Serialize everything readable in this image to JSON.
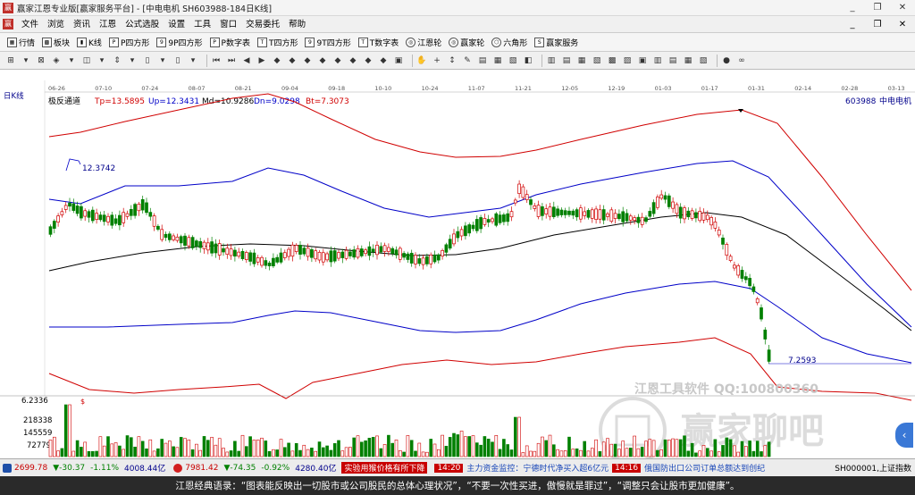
{
  "window": {
    "title": "赢家江恩专业版[赢家服务平台] - [中电电机  SH603988-184日K线]",
    "controls": [
      "_",
      "❐",
      "✕"
    ]
  },
  "menubar": {
    "items": [
      "文件",
      "浏览",
      "资讯",
      "江恩",
      "公式选股",
      "设置",
      "工具",
      "窗口",
      "交易委托",
      "帮助"
    ],
    "right_controls": [
      "_",
      "❐",
      "✕"
    ]
  },
  "toolbar1": {
    "items": [
      {
        "label": "行情",
        "icon": "grid-icon"
      },
      {
        "label": "板块",
        "icon": "blocks-icon"
      },
      {
        "label": "K线",
        "icon": "kline-icon"
      },
      {
        "label": "P四方形",
        "icon": "p-square-icon",
        "badge": "P"
      },
      {
        "label": "9P四方形",
        "icon": "9p-square-icon",
        "badge": "9"
      },
      {
        "label": "P数字表",
        "icon": "p-table-icon",
        "badge": "P"
      },
      {
        "label": "T四方形",
        "icon": "t-square-icon",
        "badge": "T"
      },
      {
        "label": "9T四方形",
        "icon": "9t-square-icon",
        "badge": "9"
      },
      {
        "label": "T数字表",
        "icon": "t-table-icon",
        "badge": "T"
      },
      {
        "label": "江恩轮",
        "icon": "gann-wheel-icon",
        "badge": "◎"
      },
      {
        "label": "赢家轮",
        "icon": "winner-wheel-icon",
        "badge": "◎"
      },
      {
        "label": "六角形",
        "icon": "hexagon-icon",
        "badge": "⬡"
      },
      {
        "label": "赢家服务",
        "icon": "service-icon",
        "badge": "S"
      }
    ]
  },
  "toolbar2": {
    "glyphs": [
      "⊞",
      "▾",
      "⊠",
      "◈",
      "▾",
      "◫",
      "▾",
      "⇕",
      "▾",
      "▯",
      "▾",
      "▯",
      "▾",
      "|",
      "⏮",
      "⏭",
      "◀",
      "▶",
      "◆",
      "◆",
      "◆",
      "◆",
      "◆",
      "◆",
      "◆",
      "◆",
      "▣",
      "|",
      "✋",
      "+",
      "↕",
      "✎",
      "▤",
      "▦",
      "▧",
      "◧",
      "|",
      "▥",
      "▤",
      "▦",
      "▧",
      "▩",
      "▨",
      "▣",
      "▥",
      "▤",
      "▦",
      "▧",
      "|",
      "●",
      "∞"
    ]
  },
  "chart": {
    "period_label": "日K线",
    "indicator_name": "极反通道",
    "indicators": [
      {
        "label": "Tp=13.5895",
        "color": "#d00000"
      },
      {
        "label": "Up=12.3431",
        "color": "#0000c8"
      },
      {
        "label": "Md=10.9286",
        "color": "#000000"
      },
      {
        "label": "Dn=9.0298",
        "color": "#0000c8"
      },
      {
        "label": "Bt=7.3073",
        "color": "#d00000"
      }
    ],
    "stock_code": "603988",
    "stock_name": "中电电机",
    "date_axis": [
      "06-26",
      "07-10",
      "07-24",
      "08-07",
      "08-21",
      "09-04",
      "09-18",
      "10-10",
      "10-24",
      "11-07",
      "11-21",
      "12-05",
      "12-19",
      "01-03",
      "01-17",
      "01-31",
      "02-14",
      "02-28",
      "03-13"
    ],
    "high_label": "12.3742",
    "low_label": "7.2593",
    "volume_axis": [
      "6.2336",
      "218338",
      "145559",
      "72779"
    ],
    "watermark_text": "江恩工具软件  QQ:100800360",
    "watermark_brand": "赢家聊吧",
    "colors": {
      "top_band": "#d00000",
      "upper_band": "#0000c8",
      "mid_band": "#000000",
      "lower_band": "#0000c8",
      "bottom_band": "#d00000",
      "up_candle": "#d00000",
      "down_candle": "#008000"
    }
  },
  "ticker": {
    "sh_index": "2699.78",
    "sh_change": "▼-30.37",
    "sh_pct": "-1.11%",
    "sh_vol": "4008.44亿",
    "sz_index": "7981.42",
    "sz_change": "▼-74.35",
    "sz_pct": "-0.92%",
    "sz_vol": "4280.40亿",
    "news1": "实验用猴价格有所下降",
    "time1": "14:20",
    "news2": "主力资金监控：宁德时代净买入超6亿元",
    "time2": "14:16",
    "news3": "俄国防出口公司订单总额达到创纪",
    "right_label": "SH000001,上证指数"
  },
  "statusbar": {
    "text": "江恩经典语录：“图表能反映出一切股市或公司股民的总体心理状况”，“不要一次性买进，傲慢就是罪过”，“调整只会让股市更加健康”。"
  }
}
